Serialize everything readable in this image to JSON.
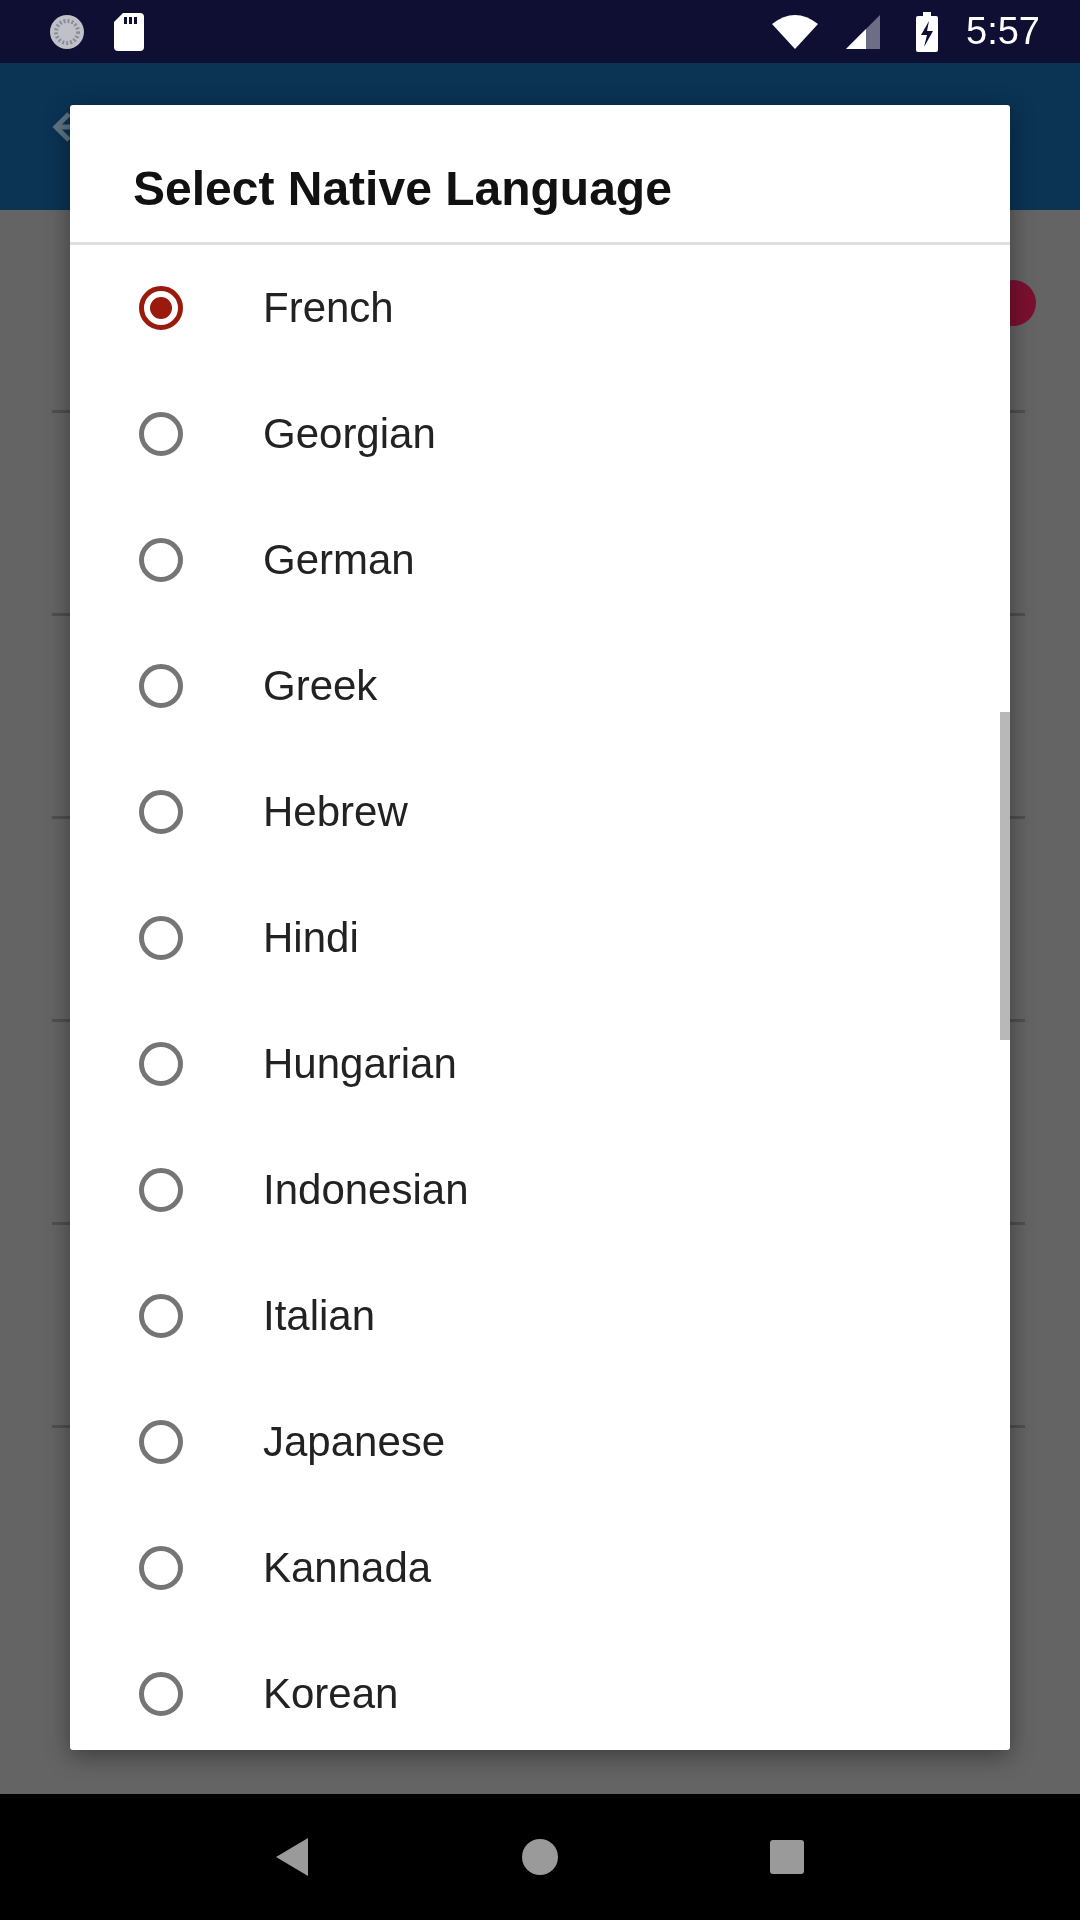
{
  "status_bar": {
    "time": "5:57"
  },
  "dialog": {
    "title": "Select Native Language",
    "options": [
      {
        "label": "French",
        "selected": true
      },
      {
        "label": "Georgian",
        "selected": false
      },
      {
        "label": "German",
        "selected": false
      },
      {
        "label": "Greek",
        "selected": false
      },
      {
        "label": "Hebrew",
        "selected": false
      },
      {
        "label": "Hindi",
        "selected": false
      },
      {
        "label": "Hungarian",
        "selected": false
      },
      {
        "label": "Indonesian",
        "selected": false
      },
      {
        "label": "Italian",
        "selected": false
      },
      {
        "label": "Japanese",
        "selected": false
      },
      {
        "label": "Kannada",
        "selected": false
      },
      {
        "label": "Korean",
        "selected": false
      }
    ]
  }
}
